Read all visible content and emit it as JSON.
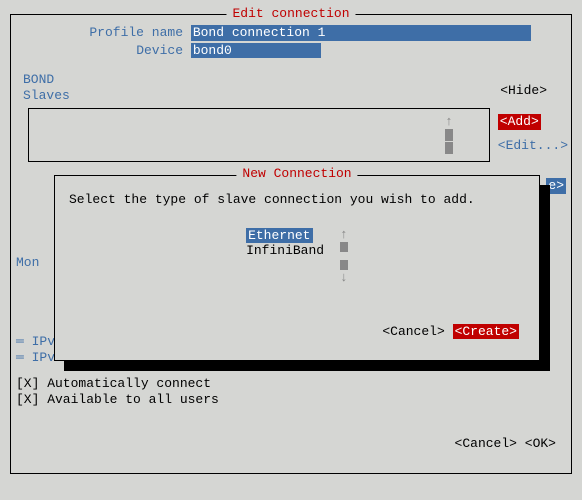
{
  "outer": {
    "title": "Edit connection",
    "profile_label": "Profile name",
    "profile_value": "Bond connection 1",
    "device_label": "Device",
    "device_value": "bond0",
    "bond_label": "BOND",
    "slaves_label": "Slaves",
    "hide_btn": "<Hide>",
    "add_btn": "<Add>",
    "edit_btn": "<Edit...>",
    "delete_trail": "e>",
    "mon_label": "Mon",
    "ipv4_label": "IPv",
    "ipv6_label": "IPv",
    "auto_connect": "[X] Automatically connect",
    "all_users": "[X] Available to all users",
    "cancel_btn": "<Cancel>",
    "ok_btn": "<OK>"
  },
  "modal": {
    "title": "New Connection",
    "prompt": "Select the type of slave connection you wish to add.",
    "options": {
      "selected": "Ethernet",
      "other": "InfiniBand"
    },
    "cancel_btn": "<Cancel>",
    "create_btn": "<Create>"
  },
  "glyphs": {
    "up": "↑",
    "down": "↓"
  }
}
